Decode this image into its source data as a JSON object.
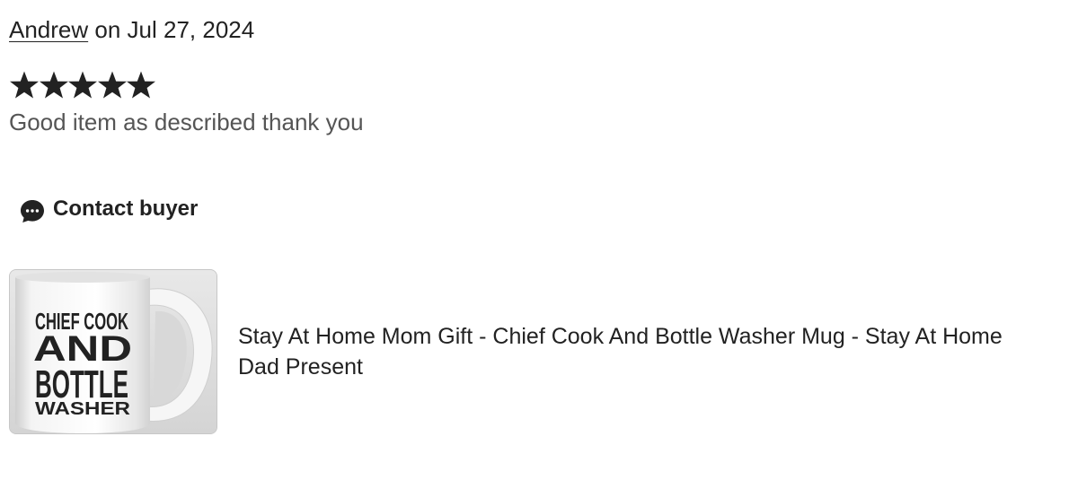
{
  "review": {
    "reviewer_name": "Andrew",
    "date_prefix": " on ",
    "date": "Jul 27, 2024",
    "rating": 5,
    "rating_max": 5,
    "text": "Good item as described thank you"
  },
  "actions": {
    "contact_label": "Contact buyer",
    "contact_icon": "chat-bubble-icon"
  },
  "product": {
    "title": "Stay At Home Mom Gift - Chief Cook And Bottle Washer Mug - Stay At Home Dad Present",
    "image": {
      "line1": "CHIEF COOK",
      "line2": "AND",
      "line3": "BOTTLE",
      "line4": "WASHER"
    }
  },
  "colors": {
    "text_primary": "#222222",
    "text_secondary": "#555555",
    "star": "#222222",
    "thumb_border": "#c7c7c7"
  },
  "icons": {
    "star": "star-icon",
    "contact": "chat-bubble-icon"
  }
}
